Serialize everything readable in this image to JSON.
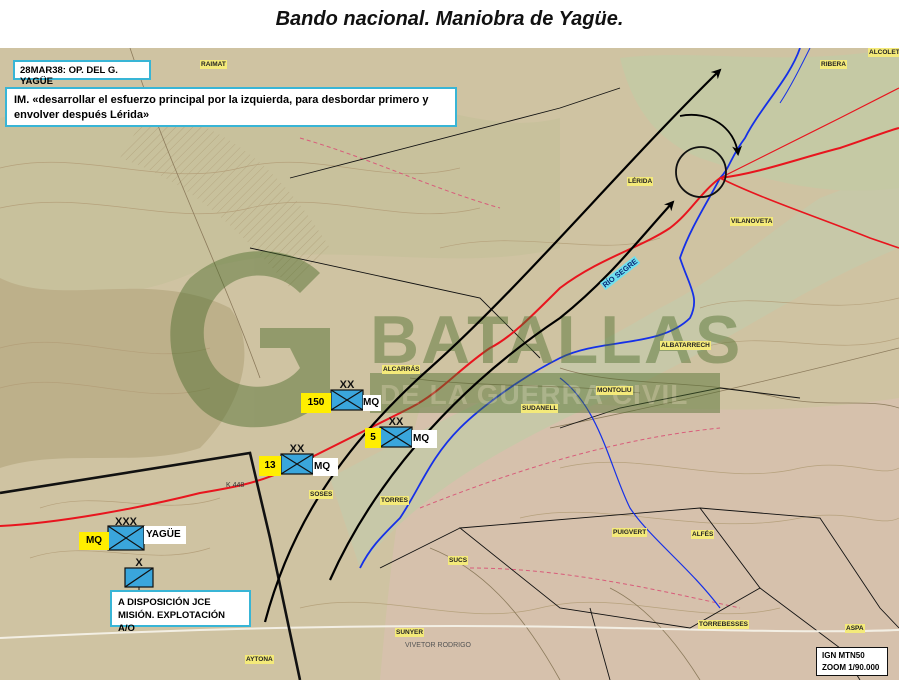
{
  "title": "Bando nacional. Maniobra de Yagüe.",
  "date_box": "28MAR38: OP. DEL G. YAGÜE",
  "intent_box": "IM. «desarrollar el esfuerzo principal por la izquierda, para desbordar primero y envolver después Lérida»",
  "reserve_box": {
    "line1": "A DISPOSICIÓN JCE",
    "line2": "MISIÓN. EXPLOTACIÓN A/O"
  },
  "scale_box": {
    "line1": "IGN MTN50",
    "line2": "ZOOM 1/90.000"
  },
  "watermark": {
    "line1": "BATALLAS",
    "line2": "DE LA GUERRA CIVIL"
  },
  "units": [
    {
      "id": "yague",
      "left_label": "MQ",
      "right_label": "YAGÜE",
      "echelon": "XXX"
    },
    {
      "id": "div150",
      "left_label": "150",
      "right_label": "MQ",
      "echelon": "XX"
    },
    {
      "id": "div13",
      "left_label": "13",
      "right_label": "MQ",
      "echelon": "XX"
    },
    {
      "id": "div5",
      "left_label": "5",
      "right_label": "MQ",
      "echelon": "XX"
    },
    {
      "id": "reserve",
      "echelon": "X"
    }
  ],
  "places": {
    "lerida": "LÉRIDA",
    "vilanoveta": "VILANOVETA",
    "alcarras": "ALCARRÁS",
    "soses": "SOSES",
    "torres": "TORRES",
    "aytona": "AYTONA",
    "sudanell": "SUDANELL",
    "albatarrech": "ALBATARRECH",
    "montoliu": "MONTOLIU",
    "rio_segre": "RÍO SEGRE",
    "k448": "K 448",
    "alfes": "ALFÉS",
    "puigvert": "PUIGVERT",
    "sucs": "SUCS",
    "alcoletge": "ALCOLETGE",
    "aspa": "ASPA",
    "ribera": "RIBERA",
    "raimat": "RAIMAT",
    "sunyer": "SUNYER",
    "torrebesses": "TORREBESSES",
    "alfes2": "ALFÉS",
    "vivetor": "VIVETOR RODRIGO"
  },
  "colors": {
    "frame": "#38b5d6",
    "unit_fill": "#3aa6dc",
    "road": "#e8151e",
    "river": "#1530e8",
    "arrow": "#000000",
    "label_bg": "#ffee00",
    "map_base": "#cfc3a2"
  },
  "icons": [
    "arrow-head-icon",
    "unit-symbol-icon",
    "objective-circle-icon"
  ]
}
